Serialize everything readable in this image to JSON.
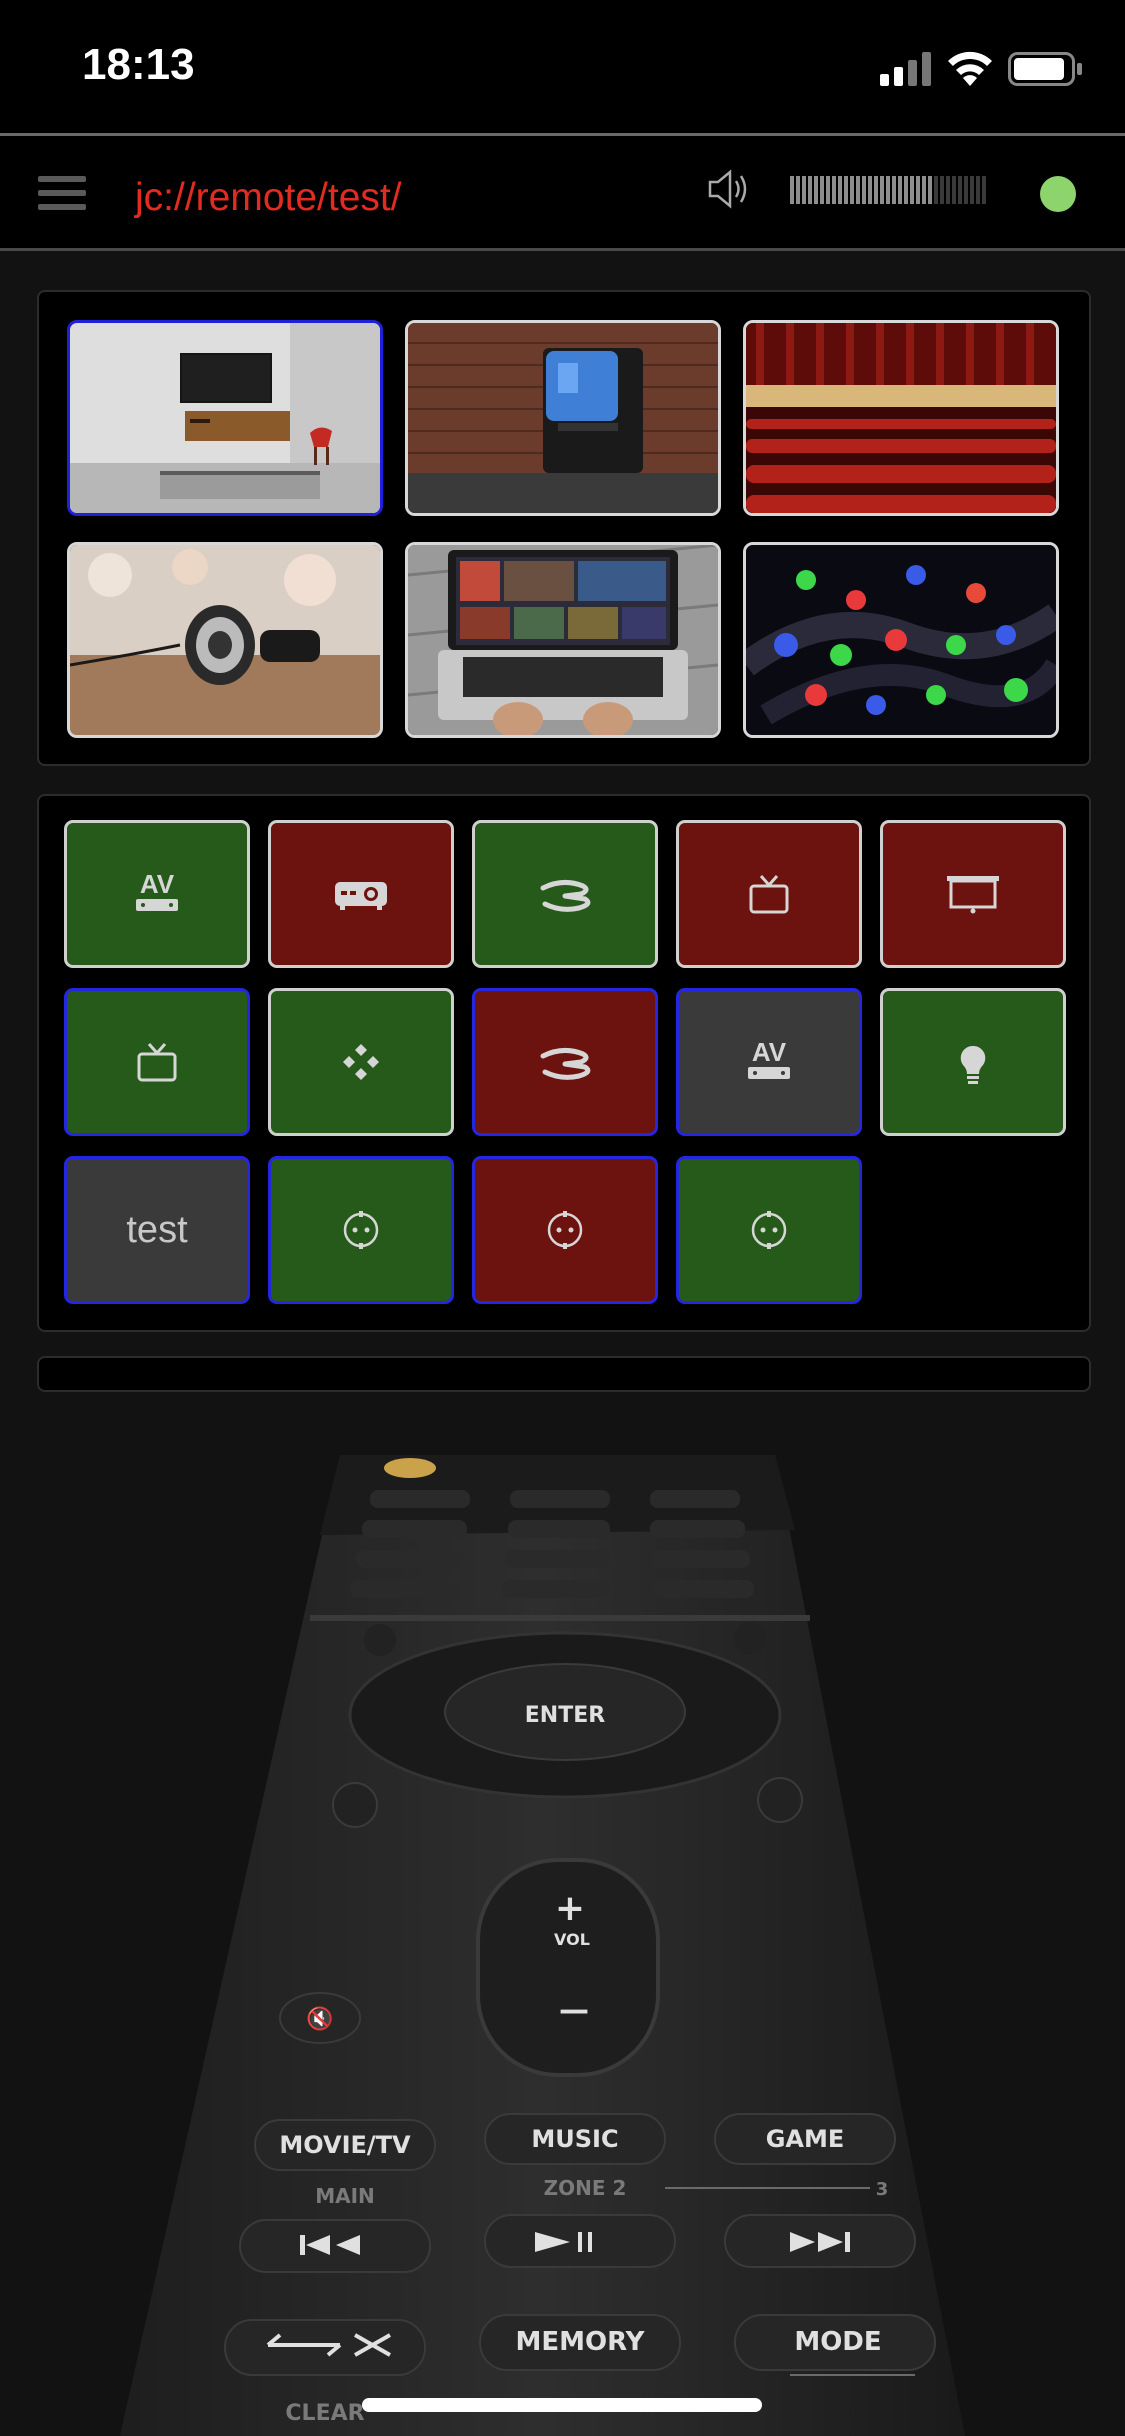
{
  "status_bar": {
    "time": "18:13"
  },
  "header": {
    "title": "jc://remote/test/",
    "volume_level": 0.72,
    "connection_color": "#8ed46c"
  },
  "scenes": [
    {
      "name": "living-room-tv",
      "active": true
    },
    {
      "name": "retro-tv",
      "active": false
    },
    {
      "name": "theater",
      "active": false
    },
    {
      "name": "headphones",
      "active": false
    },
    {
      "name": "laptop-streaming",
      "active": false
    },
    {
      "name": "led-lights",
      "active": false
    }
  ],
  "device_buttons": [
    {
      "icon": "av-receiver-icon",
      "label": "AV",
      "state": "on"
    },
    {
      "icon": "projector-icon",
      "label": "",
      "state": "off"
    },
    {
      "icon": "bluray-icon",
      "label": "",
      "state": "on"
    },
    {
      "icon": "tv-icon",
      "label": "",
      "state": "off"
    },
    {
      "icon": "screen-icon",
      "label": "",
      "state": "off"
    },
    {
      "icon": "tv-icon",
      "label": "",
      "state": "on"
    },
    {
      "icon": "kodi-icon",
      "label": "",
      "state": "on"
    },
    {
      "icon": "bluray-icon",
      "label": "",
      "state": "off"
    },
    {
      "icon": "av-receiver-icon",
      "label": "AV",
      "state": "inactive"
    },
    {
      "icon": "lightbulb-icon",
      "label": "",
      "state": "on"
    },
    {
      "icon": "none",
      "label": "test",
      "state": "inactive"
    },
    {
      "icon": "plug-icon",
      "label": "",
      "state": "on"
    },
    {
      "icon": "plug-icon",
      "label": "",
      "state": "off"
    },
    {
      "icon": "plug-icon",
      "label": "",
      "state": "on"
    }
  ],
  "remote": {
    "enter": "ENTER",
    "vol": "VOL",
    "plus": "+",
    "minus": "—",
    "mute": "🔇",
    "row1": [
      "MOVIE/TV",
      "MUSIC",
      "GAME"
    ],
    "main": "MAIN",
    "zone2": "ZONE 2",
    "zone3": "3",
    "memory": "MEMORY",
    "mode": "MODE",
    "clear": "CLEAR"
  },
  "colors": {
    "accent": "#e22b21",
    "on": "#265a1a",
    "off": "#6c120f",
    "inactive": "#3a3a3a",
    "selected_border": "#1f21d8"
  }
}
